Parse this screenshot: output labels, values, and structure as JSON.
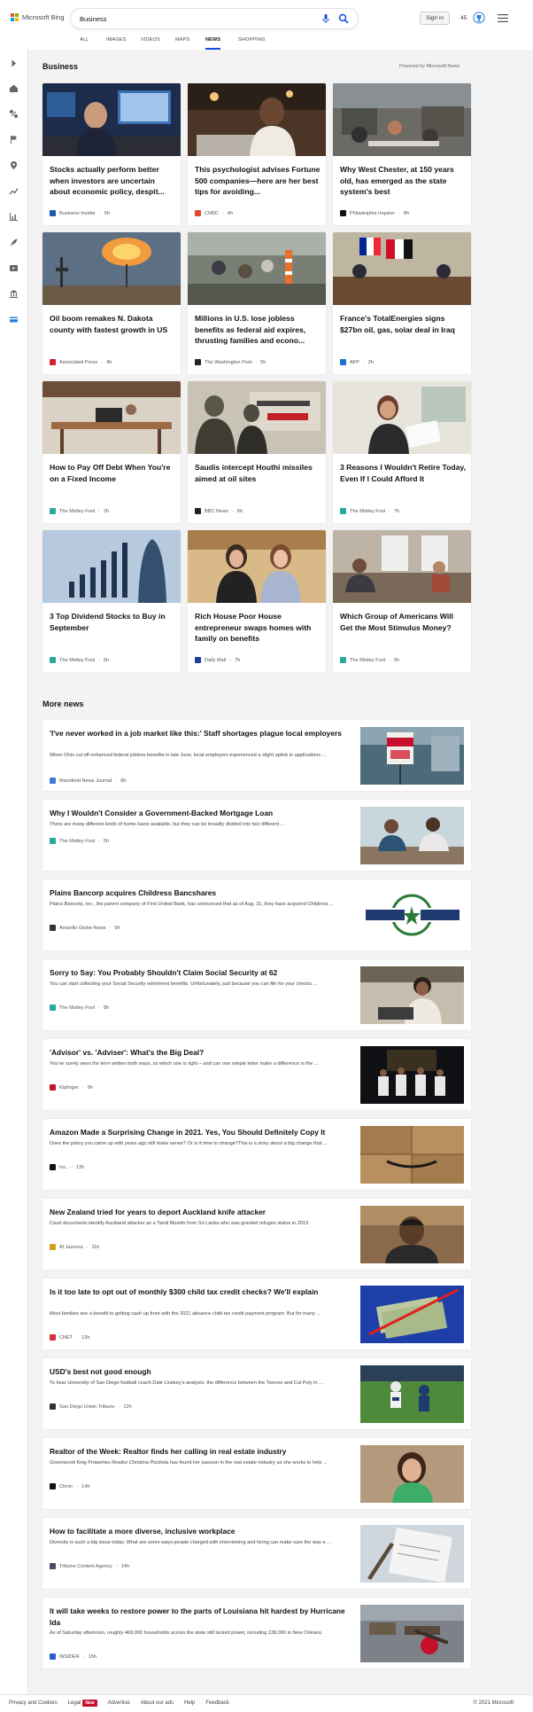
{
  "header": {
    "logo_text": "Microsoft Bing",
    "logo_colors": [
      "#f25022",
      "#7fba00",
      "#00a4ef",
      "#ffb900"
    ],
    "search_value": "Business",
    "signin_label": "Sign in",
    "rewards_count": "45",
    "accent": "#174ae4"
  },
  "tabs": [
    "ALL",
    "IMAGES",
    "VIDEOS",
    "MAPS",
    "NEWS",
    "SHOPPING"
  ],
  "active_tab": "NEWS",
  "sidebar_icons": [
    "expand-icon",
    "home-icon",
    "sports-icon",
    "flag-icon",
    "location-icon",
    "trending-icon",
    "chart-icon",
    "rocket-icon",
    "video-icon",
    "bank-icon",
    "card-icon"
  ],
  "main": {
    "section_title": "Business",
    "powered_by": "Powered by Microsoft News",
    "more_news_title": "More news"
  },
  "cards": [
    {
      "title": "Stocks actually perform better when investors are uncertain about economic policy, despit...",
      "source": "Business Insider",
      "time": "5h",
      "icon_color": "#1a5bb5"
    },
    {
      "title": "This psychologist advises Fortune 500 companies—here are her best tips for avoiding...",
      "source": "CNBC",
      "time": "4h",
      "icon_color": "#e04b2a"
    },
    {
      "title": "Why West Chester, at 150 years old, has emerged as the state system's best",
      "source": "Philadelphia Inquirer",
      "time": "8h",
      "icon_color": "#111111"
    },
    {
      "title": "Oil boom remakes N. Dakota county with fastest growth in US",
      "source": "Associated Press",
      "time": "4h",
      "icon_color": "#d21f2a"
    },
    {
      "title": "Millions in U.S. lose jobless benefits as federal aid expires, thrusting families and econo...",
      "source": "The Washington Post",
      "time": "5h",
      "icon_color": "#222222"
    },
    {
      "title": "France's TotalEnergies signs $27bn oil, gas, solar deal in Iraq",
      "source": "AFP",
      "time": "2h",
      "icon_color": "#1f6fd6"
    },
    {
      "title": "How to Pay Off Debt When You're on a Fixed Income",
      "source": "The Motley Fool",
      "time": "2h",
      "icon_color": "#2aa89a"
    },
    {
      "title": "Saudis intercept Houthi missiles aimed at oil sites",
      "source": "BBC News",
      "time": "6h",
      "icon_color": "#222222"
    },
    {
      "title": "3 Reasons I Wouldn't Retire Today, Even If I Could Afford It",
      "source": "The Motley Fool",
      "time": "7h",
      "icon_color": "#2aa89a"
    },
    {
      "title": "3 Top Dividend Stocks to Buy in September",
      "source": "The Motley Fool",
      "time": "5h",
      "icon_color": "#2aa89a"
    },
    {
      "title": "Rich House Poor House entrepreneur swaps homes with family on benefits",
      "source": "Daily Mail",
      "time": "7h",
      "icon_color": "#1b3f96"
    },
    {
      "title": "Which Group of Americans Will Get the Most Stimulus Money?",
      "source": "The Motley Fool",
      "time": "6h",
      "icon_color": "#2aa89a"
    }
  ],
  "more_news": [
    {
      "title": "'I've never worked in a job market like this:' Staff shortages plague local employers",
      "snippet": "When Ohio cut off enhanced federal jobless benefits in late June, local employers experienced a slight uptick in applications ...",
      "source": "Mansfield News Journal",
      "time": "8h",
      "icon_color": "#3a7bd5"
    },
    {
      "title": "Why I Wouldn't Consider a Government-Backed Mortgage Loan",
      "snippet": "There are many different kinds of home loans available, but they can be broadly divided into two different ...",
      "source": "The Motley Fool",
      "time": "5h",
      "icon_color": "#2aa89a"
    },
    {
      "title": "Plains Bancorp acquires Childress Bancshares",
      "snippet": "Plains Bancorp, Inc., the parent company of First United Bank, has announced that as of Aug. 31, they have acquired Childress ...",
      "source": "Amarillo Globe-News",
      "time": "9h",
      "icon_color": "#333333"
    },
    {
      "title": "Sorry to Say: You Probably Shouldn't Claim Social Security at 62",
      "snippet": "You can start collecting your Social Security retirement benefits. Unfortunately, just because you can file for your checks ...",
      "source": "The Motley Fool",
      "time": "8h",
      "icon_color": "#2aa89a"
    },
    {
      "title": "'Advisor' vs. 'Adviser': What's the Big Deal?",
      "snippet": "You've surely seen the term written both ways, so which one is right – and can one simple letter make a difference in the ...",
      "source": "Kiplinger",
      "time": "9h",
      "icon_color": "#c8102e"
    },
    {
      "title": "Amazon Made a Surprising Change in 2021. Yes, You Should Definitely Copy It",
      "snippet": "Does the policy you came up with years ago still make sense? Or is it time to change?This is a story about a big change that ...",
      "source": "Inc.",
      "time": "13h",
      "icon_color": "#111111"
    },
    {
      "title": "New Zealand tried for years to deport Auckland knife attacker",
      "snippet": "Court documents identify Auckland attacker as a Tamil Muslim from Sri Lanka who was granted refugee status in 2013.",
      "source": "Al Jazeera",
      "time": "11h",
      "icon_color": "#d4a017"
    },
    {
      "title": "Is it too late to opt out of monthly $300 child tax credit checks? We'll explain",
      "snippet": "Most families see a benefit to getting cash up front with the 2021 advance child tax credit payment program. But for many ...",
      "source": "CNET",
      "time": "13h",
      "icon_color": "#d6303a"
    },
    {
      "title": "USD's best not good enough",
      "snippet": "To hear University of San Diego football coach Dale Lindsey's analysis, the difference between the Toreros and Cal Poly in ...",
      "source": "San Diego Union Tribune",
      "time": "12h",
      "icon_color": "#333333"
    },
    {
      "title": "Realtor of the Week: Realtor finds her calling in real estate industry",
      "snippet": "Greenwood King Properties Realtor Christina Pizzitola has found her passion in the real estate industry as she works to help ...",
      "source": "Chron",
      "time": "14h",
      "icon_color": "#111111"
    },
    {
      "title": "How to facilitate a more diverse, inclusive workplace",
      "snippet": "Diversity is such a big issue today. What are some ways people charged with interviewing and hiring can make sure the way a ...",
      "source": "Tribune Content Agency",
      "time": "14h",
      "icon_color": "#4a4a6a"
    },
    {
      "title": "It will take weeks to restore power to the parts of Louisiana hit hardest by Hurricane Ida",
      "snippet": "As of Saturday afternoon, roughly 469,000 households across the state still lacked power, including 138,000 in New Orleans.",
      "source": "INSIDER",
      "time": "15h",
      "icon_color": "#2a5bd7"
    }
  ],
  "footer": {
    "links": [
      "Privacy and Cookies",
      "Legal",
      "Advertise",
      "About our ads",
      "Help",
      "Feedback"
    ],
    "new_badge": "New",
    "copyright": "© 2021 Microsoft"
  }
}
